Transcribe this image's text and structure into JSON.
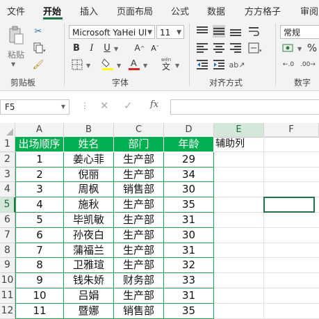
{
  "ribbon_tabs": [
    "文件",
    "开始",
    "插入",
    "页面布局",
    "公式",
    "数据",
    "方方格子",
    "审阅"
  ],
  "active_tab": "开始",
  "clipboard": {
    "paste_label": "粘贴",
    "group_label": "剪贴板"
  },
  "font": {
    "name": "Microsoft YaHei UI",
    "size": "11",
    "group_label": "字体",
    "wen_label": "wén",
    "wen_char": "文"
  },
  "alignment": {
    "group_label": "对齐方式"
  },
  "number": {
    "format": "常规",
    "group_label": "数字"
  },
  "formula_bar": {
    "name_box": "F5",
    "fx_label": "fx",
    "formula": ""
  },
  "columns": [
    "A",
    "B",
    "C",
    "D",
    "E",
    "F"
  ],
  "selected_column": "F",
  "selected_row": "5",
  "rows": [
    "1",
    "2",
    "3",
    "4",
    "5",
    "6",
    "7",
    "8",
    "9",
    "10",
    "11",
    "12"
  ],
  "table": {
    "headers": [
      "出场顺序",
      "姓名",
      "部门",
      "年龄"
    ],
    "helper_header": "辅助列",
    "data": [
      [
        "1",
        "姜心菲",
        "生产部",
        "29"
      ],
      [
        "2",
        "倪丽",
        "生产部",
        "34"
      ],
      [
        "3",
        "周枫",
        "销售部",
        "30"
      ],
      [
        "4",
        "施秋",
        "生产部",
        "35"
      ],
      [
        "5",
        "毕凯敏",
        "生产部",
        "31"
      ],
      [
        "6",
        "孙夜白",
        "生产部",
        "30"
      ],
      [
        "7",
        "蒲福兰",
        "生产部",
        "31"
      ],
      [
        "8",
        "卫雅瑄",
        "生产部",
        "32"
      ],
      [
        "9",
        "钱朱娇",
        "财务部",
        "33"
      ],
      [
        "10",
        "吕娟",
        "生产部",
        "31"
      ],
      [
        "11",
        "暨娜",
        "销售部",
        "35"
      ]
    ]
  },
  "colors": {
    "accent": "#217346",
    "header_fill": "#00b050",
    "table_border": "#1fa34a"
  }
}
